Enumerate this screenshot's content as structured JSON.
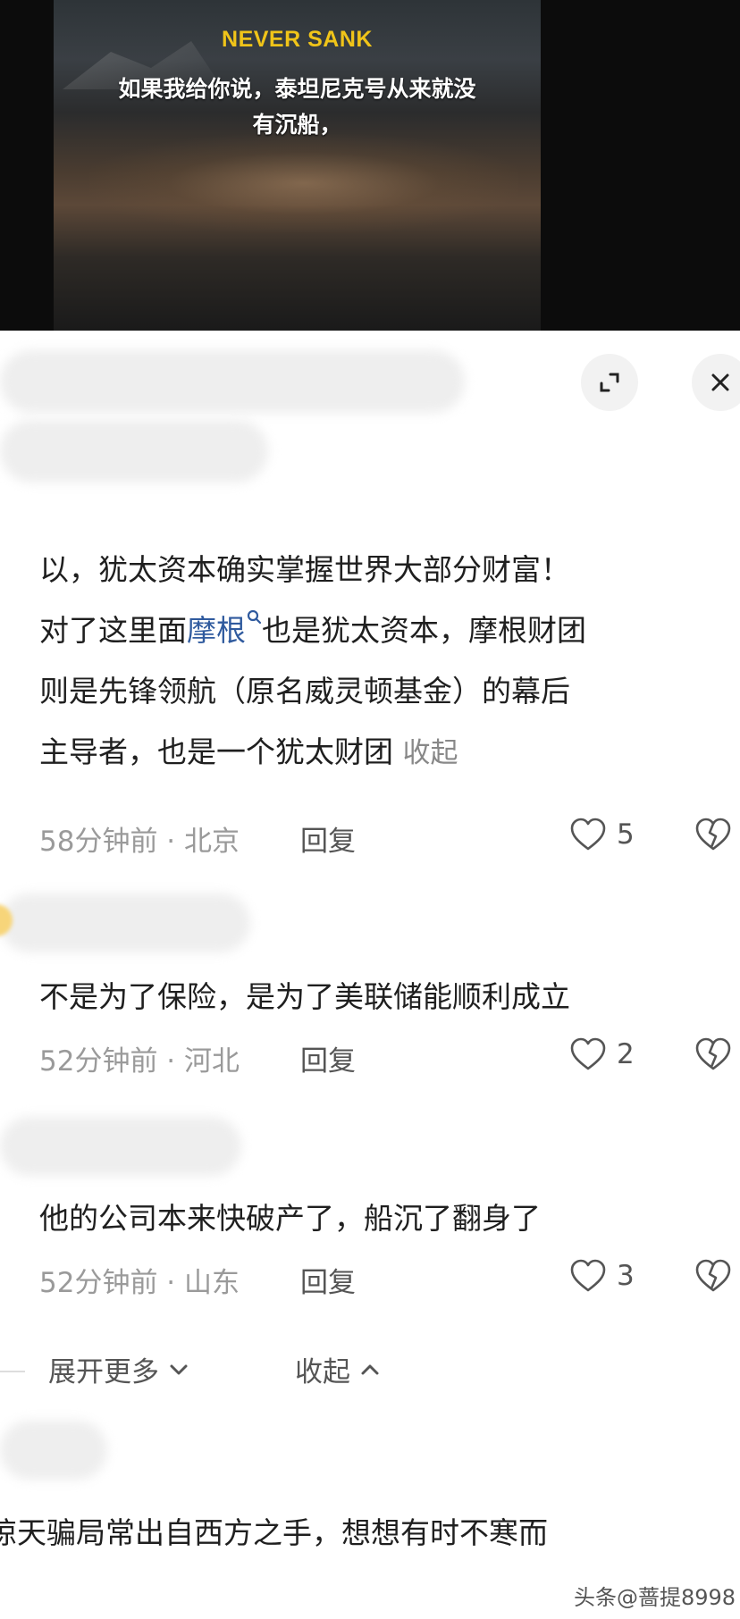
{
  "video": {
    "title": "NEVER SANK",
    "subtitle_line1": "如果我给你说，泰坦尼克号从来就没",
    "subtitle_line2": "有沉船，"
  },
  "header": {
    "expand_icon": "expand-icon",
    "close_icon": "close-icon"
  },
  "comments": [
    {
      "line1": "以，犹太资本确实掌握世界大部分财富！",
      "line2_pre": "对了这里面",
      "line2_link": "摩根",
      "line2_post": "也是犹太资本，摩根财团",
      "line3": "则是先锋领航（原名威灵顿基金）的幕后",
      "line4": "主导者，也是一个犹太财团",
      "collapse": "收起",
      "meta": "58分钟前 · 北京",
      "reply": "回复",
      "likes": "5"
    },
    {
      "text": "不是为了保险，是为了美联储能顺利成立",
      "meta": "52分钟前 · 河北",
      "reply": "回复",
      "likes": "2"
    },
    {
      "text": "他的公司本来快破产了，船沉了翻身了",
      "meta": "52分钟前 · 山东",
      "reply": "回复",
      "likes": "3"
    }
  ],
  "expand": {
    "more": "展开更多",
    "collapse": "收起"
  },
  "partial_comment": "惊天骗局常出自西方之手，想想有时不寒而",
  "watermark": "头条@蔷提8998"
}
